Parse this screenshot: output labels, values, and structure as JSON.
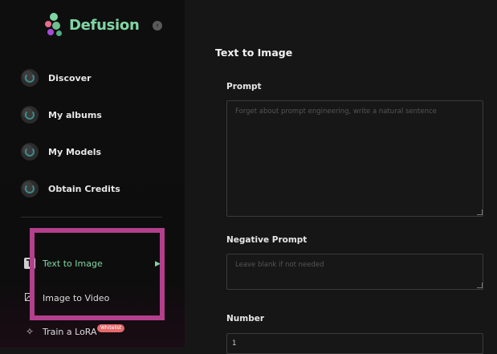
{
  "app": {
    "name": "Defusion"
  },
  "sidebar": {
    "collapse_icon": "chevron-left-icon",
    "nav_items": [
      {
        "label": "Discover",
        "icon": "planet-icon"
      },
      {
        "label": "My albums",
        "icon": "disc-icon"
      },
      {
        "label": "My Models",
        "icon": "disc-icon"
      },
      {
        "label": "Obtain Credits",
        "icon": "credits-icon"
      }
    ],
    "tools": [
      {
        "label": "Text to Image",
        "icon": "text-icon",
        "active": true
      },
      {
        "label": "Image to Video",
        "icon": "image-icon",
        "active": false
      },
      {
        "label": "Train a LoRA",
        "icon": "train-icon",
        "badge": "Whitelist"
      }
    ]
  },
  "main": {
    "title": "Text to Image",
    "prompt": {
      "label": "Prompt",
      "placeholder": "Forget about prompt engineering, write a natural sentence",
      "value": ""
    },
    "negative_prompt": {
      "label": "Negative Prompt",
      "placeholder": "Leave blank if not needed",
      "value": ""
    },
    "number": {
      "label": "Number",
      "value": "1"
    }
  },
  "colors": {
    "accent": "#7fd6a4",
    "highlight": "#b43f8c",
    "badge": "#e46a6a",
    "background": "#161616",
    "sidebar": "#0e0e0e"
  }
}
